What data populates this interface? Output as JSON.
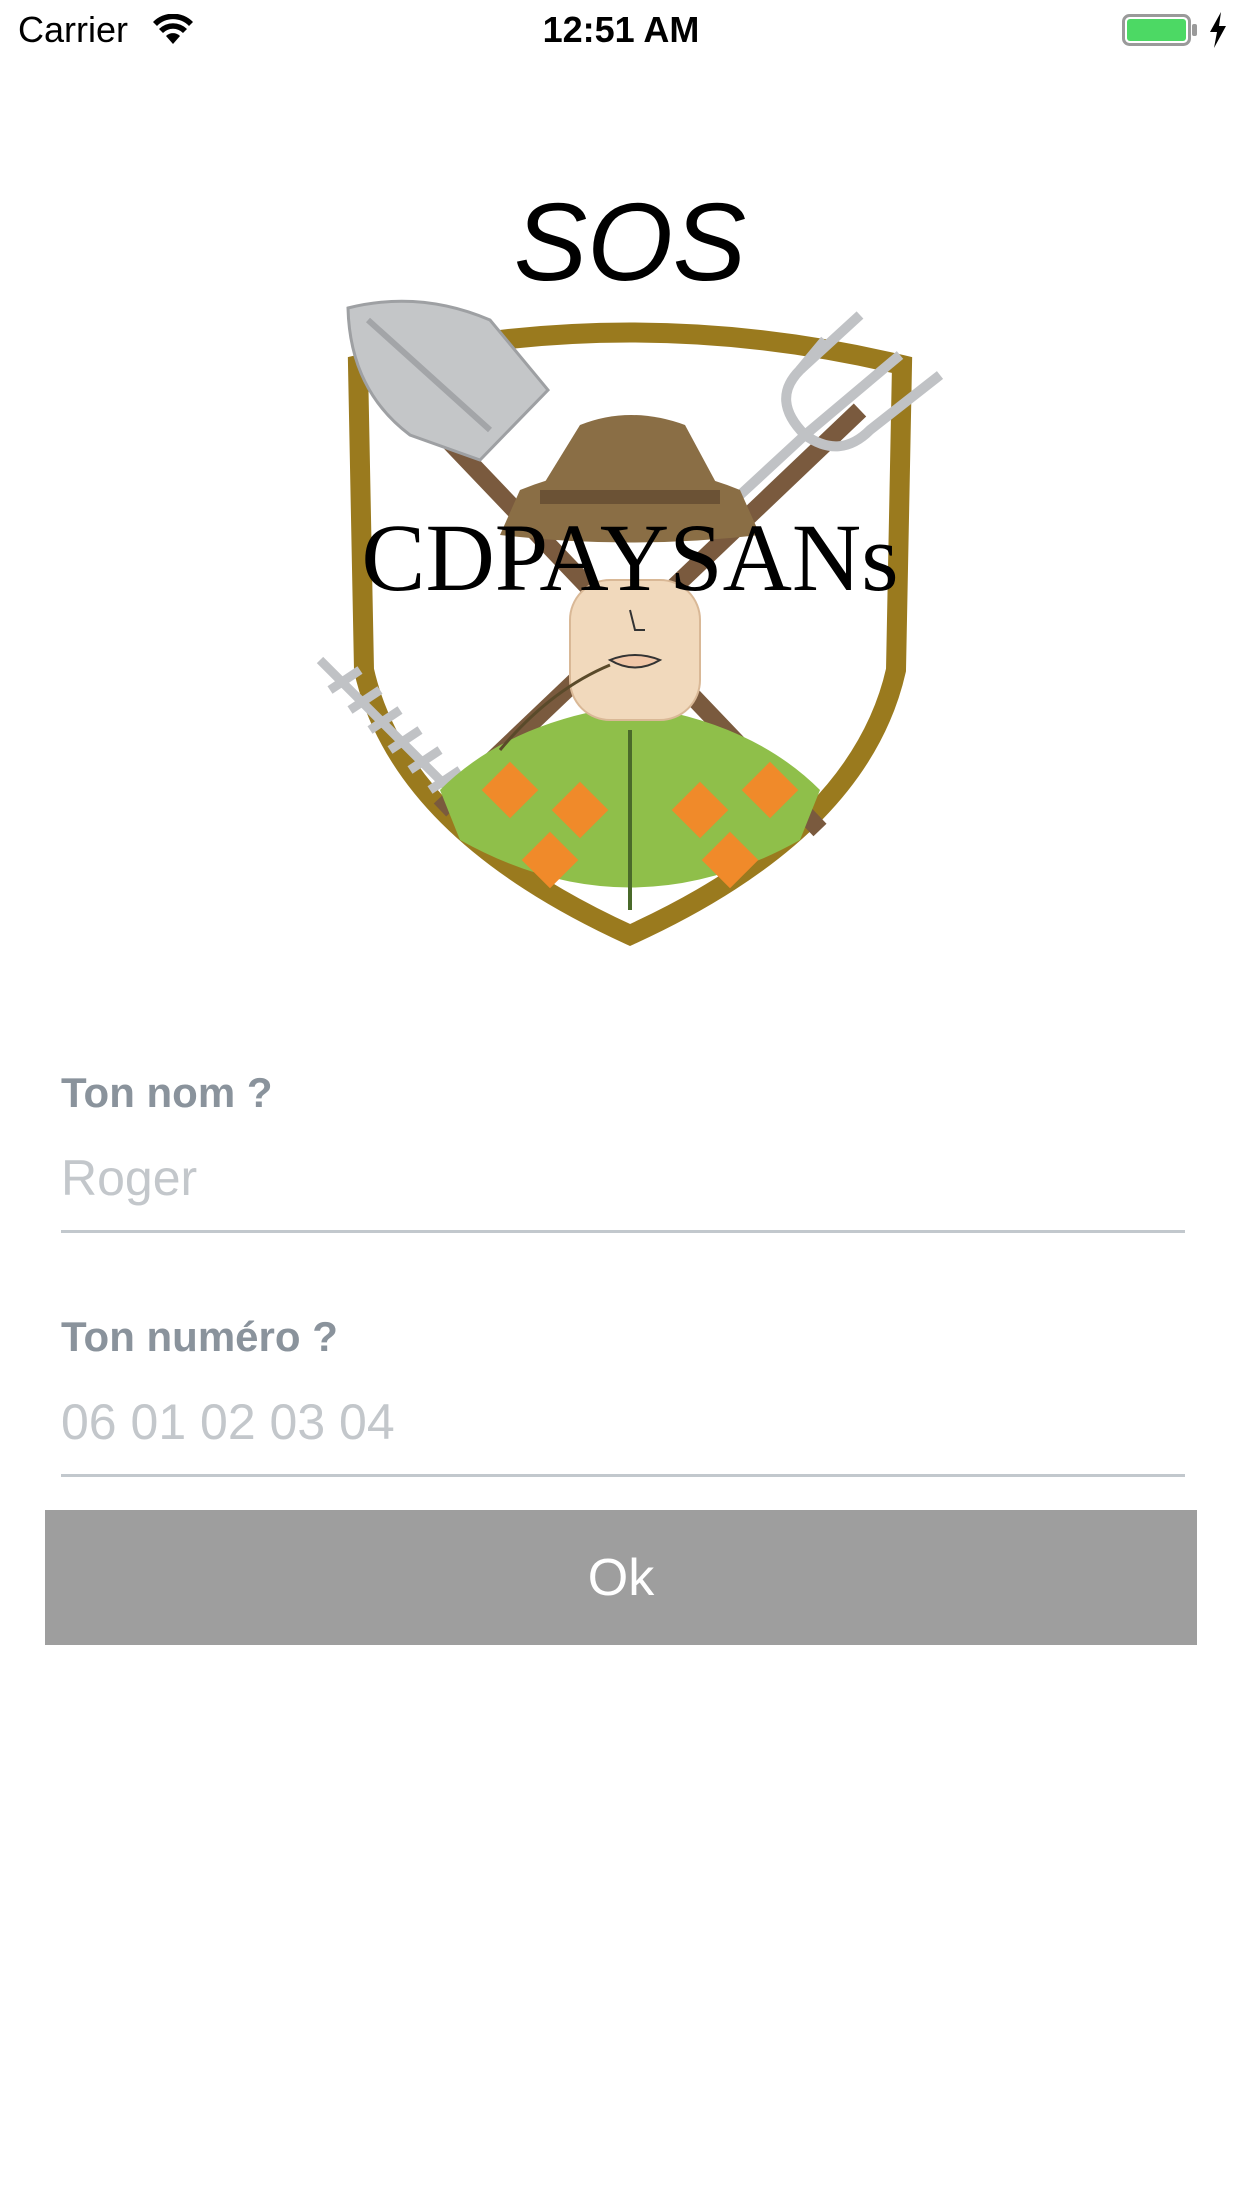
{
  "status_bar": {
    "carrier": "Carrier",
    "time": "12:51 AM",
    "icons": [
      "wifi-icon",
      "battery-icon",
      "charging-icon"
    ],
    "battery_color": "#4cd964"
  },
  "logo": {
    "top_text": "SOS",
    "banner_text": "CDPAYSANs"
  },
  "form": {
    "name_label": "Ton nom ?",
    "name_placeholder": "Roger",
    "number_label": "Ton numéro ?",
    "number_placeholder": "06 01 02 03 04",
    "ok_label": "Ok"
  },
  "colors": {
    "label": "#8a939c",
    "placeholder": "#c3c7cb",
    "button_bg": "#9e9e9e",
    "button_text": "#ffffff"
  }
}
